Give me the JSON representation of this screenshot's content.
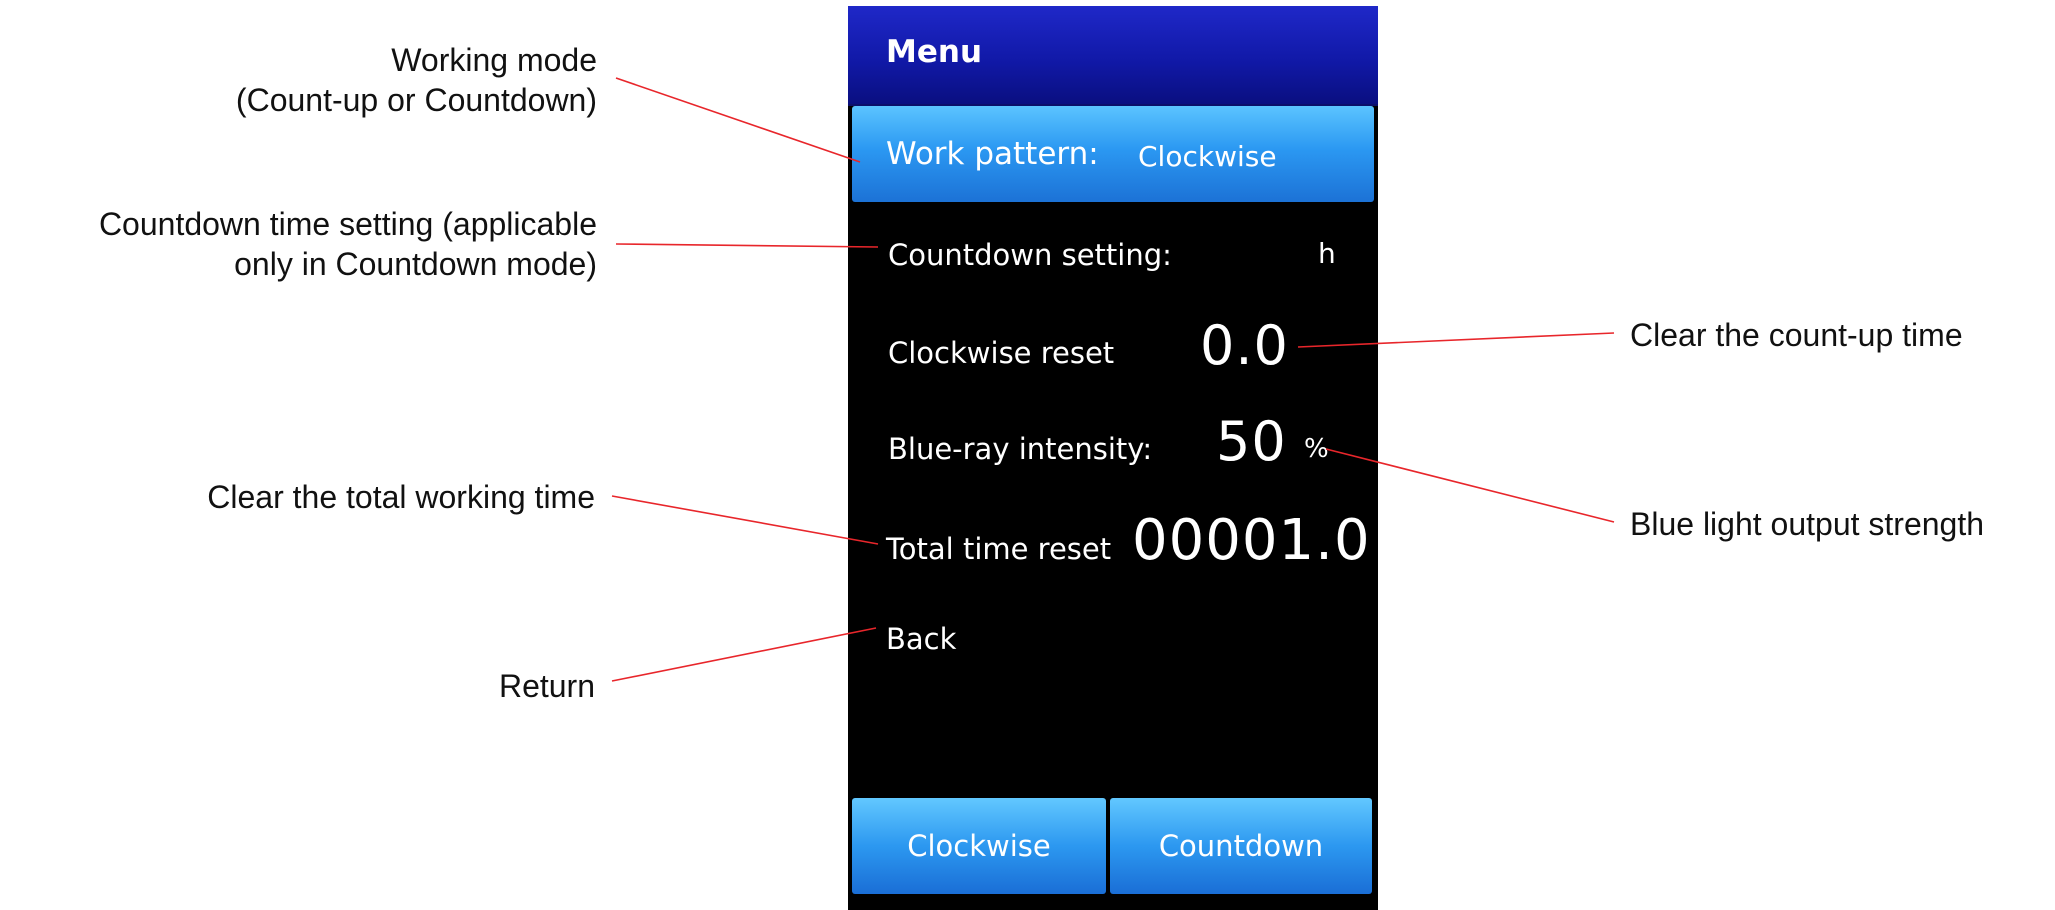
{
  "device": {
    "menu_title": "Menu",
    "work_pattern": {
      "label": "Work pattern:",
      "value": "Clockwise"
    },
    "countdown_setting": {
      "label": "Countdown setting:",
      "unit": "h"
    },
    "clockwise_reset": {
      "label": "Clockwise reset",
      "value": "0.0"
    },
    "blue_ray_intensity": {
      "label": "Blue-ray intensity:",
      "value": "50",
      "unit": "%"
    },
    "total_time_reset": {
      "label": "Total time reset",
      "value": "00001.0"
    },
    "back": {
      "label": "Back"
    },
    "buttons": {
      "clockwise": "Clockwise",
      "countdown": "Countdown"
    }
  },
  "annotations": {
    "working_mode": {
      "line1": "Working mode",
      "line2": "(Count-up or Countdown)"
    },
    "countdown_time_setting": {
      "line1": "Countdown time setting (applicable",
      "line2": "only in Countdown mode)"
    },
    "clear_total_working_time": "Clear the total working time",
    "return": "Return",
    "clear_count_up_time": "Clear the count-up time",
    "blue_light_output_strength": "Blue light output strength"
  },
  "colors": {
    "header_blue": "#1119a8",
    "highlight_blue": "#2b98f2",
    "button_blue": "#2c98f0",
    "leader_line": "#e8262b",
    "screen_bg": "#000000"
  }
}
